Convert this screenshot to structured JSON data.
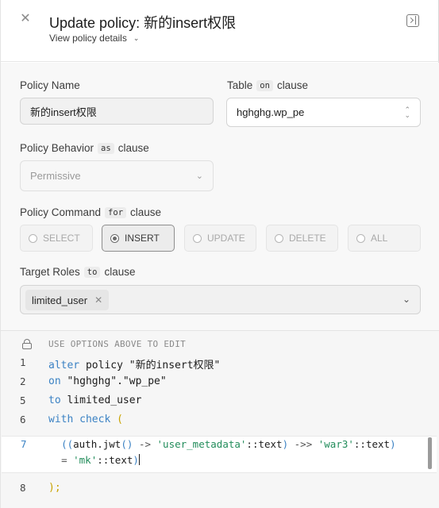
{
  "header": {
    "title": "Update policy: 新的insert权限",
    "details_link": "View policy details",
    "close_icon": "close-icon",
    "panel_toggle_icon": "sidebar-collapse-icon"
  },
  "form": {
    "policy_name": {
      "label": "Policy Name",
      "value": "新的insert权限"
    },
    "table": {
      "label_prefix": "Table",
      "label_code": "on",
      "label_suffix": "clause",
      "value": "hghghg.wp_pe"
    },
    "behavior": {
      "label_prefix": "Policy Behavior",
      "label_code": "as",
      "label_suffix": "clause",
      "value": "Permissive"
    },
    "command": {
      "label_prefix": "Policy Command",
      "label_code": "for",
      "label_suffix": "clause",
      "options": [
        "SELECT",
        "INSERT",
        "UPDATE",
        "DELETE",
        "ALL"
      ],
      "selected": "INSERT"
    },
    "roles": {
      "label_prefix": "Target Roles",
      "label_code": "to",
      "label_suffix": "clause",
      "chips": [
        "limited_user"
      ]
    }
  },
  "editor": {
    "note": "USE OPTIONS ABOVE TO EDIT",
    "lines": [
      {
        "num": "1",
        "parts": [
          [
            "kw",
            "alter"
          ],
          [
            "txt",
            " policy \"新的insert权限\""
          ]
        ]
      },
      {
        "num": "2",
        "parts": [
          [
            "kw",
            "on"
          ],
          [
            "txt",
            " \"hghghg\".\"wp_pe\""
          ]
        ]
      },
      {
        "num": "5",
        "parts": [
          [
            "kw",
            "to"
          ],
          [
            "txt",
            " limited_user"
          ]
        ]
      },
      {
        "num": "6",
        "parts": [
          [
            "kw",
            "with check"
          ],
          [
            "paren",
            " ("
          ]
        ]
      }
    ],
    "active_line": {
      "num": "7",
      "row1": "  ((auth.jwt() -> 'user_metadata'::text) ->> 'war3'::text)",
      "row2": "  = 'mk'::text)"
    },
    "last_line": {
      "num": "8",
      "text": ");"
    }
  },
  "colors": {
    "keyword": "#3b82c4",
    "string": "#218c5a",
    "paren": "#c9a300"
  }
}
